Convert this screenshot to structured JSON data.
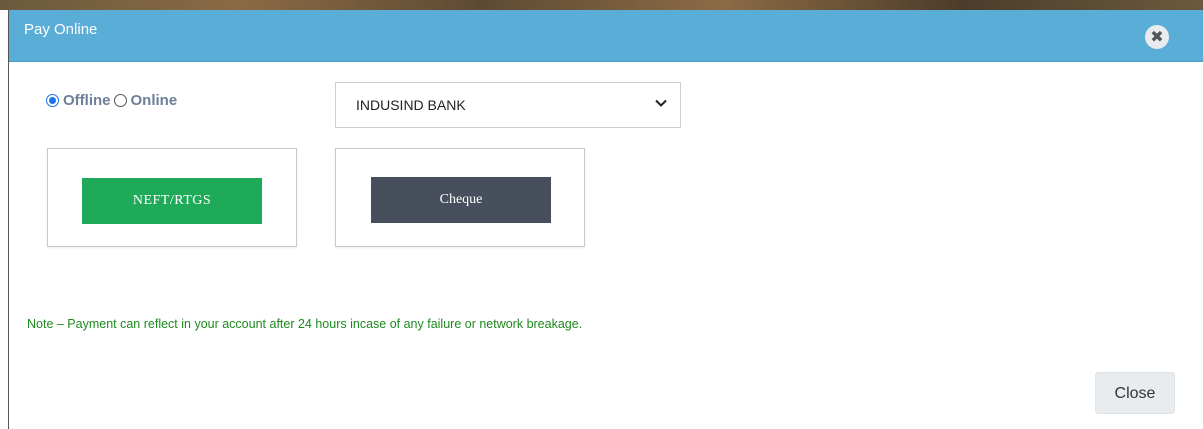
{
  "modal": {
    "title": "Pay Online",
    "close_icon_glyph": "✖"
  },
  "payment_mode": {
    "options": [
      {
        "label": "Offline",
        "selected": true
      },
      {
        "label": "Online",
        "selected": false
      }
    ]
  },
  "bank_select": {
    "selected": "INDUSIND BANK"
  },
  "methods": {
    "neft_label": "NEFT/RTGS",
    "cheque_label": "Cheque"
  },
  "note": "Note – Payment can reflect in your account after 24 hours incase of any failure or network breakage.",
  "footer": {
    "close_label": "Close"
  },
  "colors": {
    "header": "#5aadd6",
    "neft_button": "#1faa5a",
    "cheque_button": "#474f5c",
    "note_text": "#1e8a1e"
  },
  "icons": {
    "close": "close-icon",
    "dropdown": "chevron-down-icon"
  }
}
